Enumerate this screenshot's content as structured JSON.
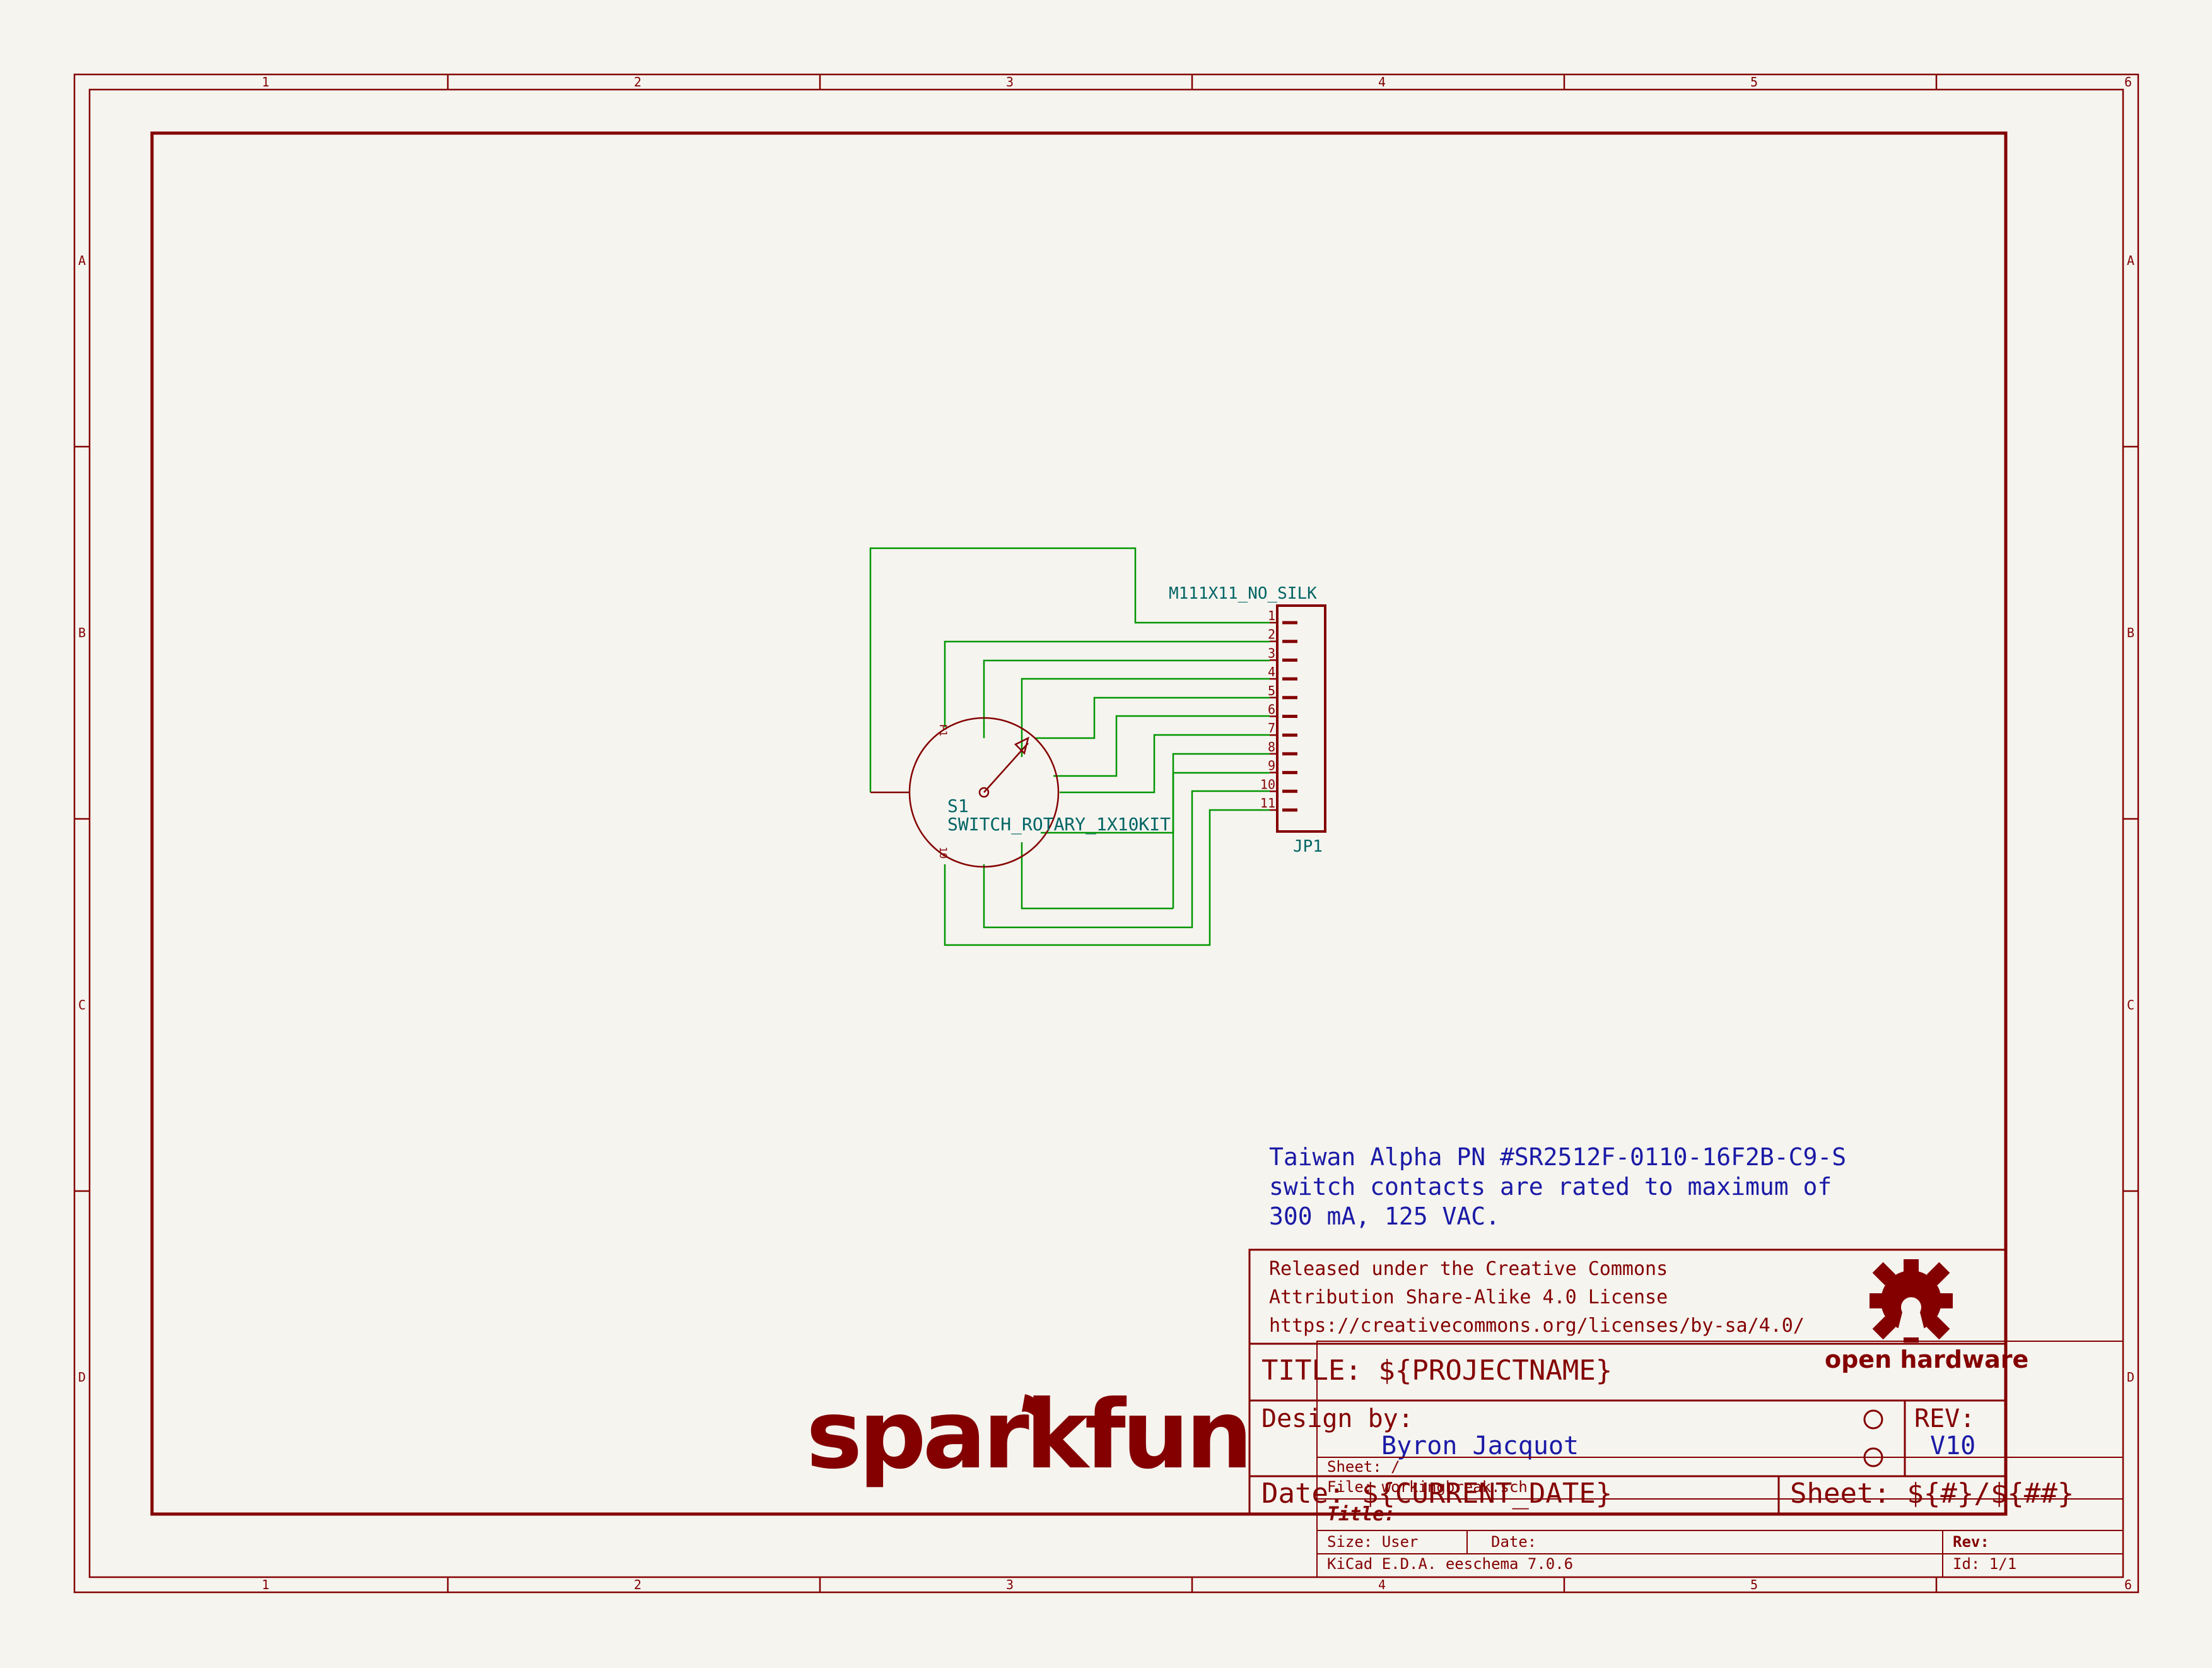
{
  "frame": {
    "columns": [
      "1",
      "2",
      "3",
      "4",
      "5",
      "6"
    ],
    "rows": [
      "A",
      "B",
      "C",
      "D"
    ]
  },
  "components": {
    "connector": {
      "value": "M111X11_NO_SILK",
      "ref": "JP1",
      "pins": [
        "1",
        "2",
        "3",
        "4",
        "5",
        "6",
        "7",
        "8",
        "9",
        "10",
        "11"
      ]
    },
    "switch": {
      "ref": "S1",
      "value": "SWITCH_ROTARY_1X10KIT",
      "pin_labels": [
        "P1",
        "10"
      ]
    }
  },
  "note": {
    "lines": [
      "Taiwan Alpha PN #SR2512F-0110-16F2B-C9-S",
      "switch contacts are rated to maximum of",
      "300 mA, 125 VAC."
    ]
  },
  "license": {
    "lines": [
      "Released under the Creative Commons",
      "Attribution Share-Alike 4.0 License",
      "https://creativecommons.org/licenses/by-sa/4.0/"
    ]
  },
  "logo": {
    "oshw_text": "open hardware",
    "brand": "sparkfun"
  },
  "title_block": {
    "title": "TITLE:  ${PROJECTNAME}",
    "design_by_label": "Design by:",
    "designer": "Byron Jacquot",
    "rev_label": "REV:",
    "rev": "V10",
    "date": "Date: ${CURRENT_DATE}",
    "sheet": "Sheet: ${#}/${##}"
  },
  "kicad_block": {
    "sheet": "Sheet: /",
    "file": "File: workingbreak.sch",
    "title": "Title:",
    "size": "Size: User",
    "date": "Date:",
    "rev": "Rev:",
    "tool": "KiCad E.D.A.  eeschema 7.0.6",
    "id": "Id: 1/1"
  }
}
